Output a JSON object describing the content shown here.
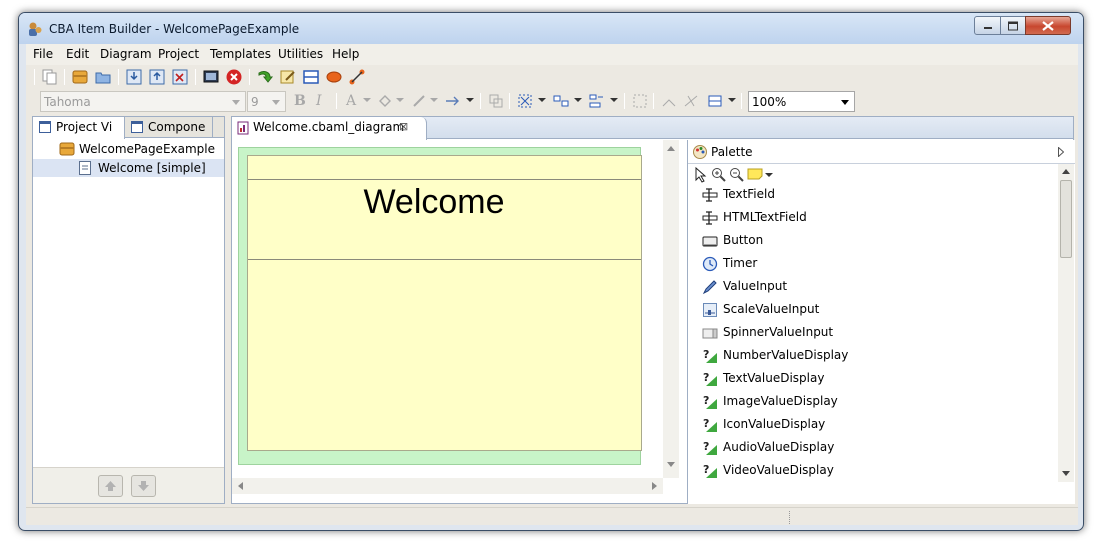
{
  "window": {
    "title": "CBA Item Builder - WelcomePageExample"
  },
  "menu": [
    "File",
    "Edit",
    "Diagram",
    "Project",
    "Templates",
    "Utilities",
    "Help"
  ],
  "toolbar": {
    "font_name": "Tahoma",
    "font_size": "9",
    "bold_label": "B",
    "italic_label": "I",
    "font_color_label": "A",
    "zoom": "100%"
  },
  "left_panel": {
    "tabs": [
      "Project Vi",
      "Compone"
    ],
    "tree": [
      {
        "label": "WelcomePageExample",
        "icon": "project-icon"
      },
      {
        "label": "Welcome [simple]",
        "icon": "page-icon",
        "selected": true
      }
    ]
  },
  "editor": {
    "tab_label": "Welcome.cbaml_diagram",
    "tab_close": "⊠",
    "page_heading": "Welcome",
    "page_color": "#ffffc8",
    "frame_color": "#c8f4c8"
  },
  "palette": {
    "title": "Palette",
    "items": [
      {
        "label": "TextField",
        "icon": "textfield-icon"
      },
      {
        "label": "HTMLTextField",
        "icon": "htmltextfield-icon"
      },
      {
        "label": "Button",
        "icon": "button-icon"
      },
      {
        "label": "Timer",
        "icon": "timer-icon"
      },
      {
        "label": "ValueInput",
        "icon": "pen-icon"
      },
      {
        "label": "ScaleValueInput",
        "icon": "scale-icon"
      },
      {
        "label": "SpinnerValueInput",
        "icon": "spinner-icon"
      },
      {
        "label": "NumberValueDisplay",
        "icon": "value-display-icon"
      },
      {
        "label": "TextValueDisplay",
        "icon": "value-display-icon"
      },
      {
        "label": "ImageValueDisplay",
        "icon": "value-display-icon"
      },
      {
        "label": "IconValueDisplay",
        "icon": "value-display-icon"
      },
      {
        "label": "AudioValueDisplay",
        "icon": "value-display-icon"
      },
      {
        "label": "VideoValueDisplay",
        "icon": "value-display-icon"
      }
    ]
  }
}
